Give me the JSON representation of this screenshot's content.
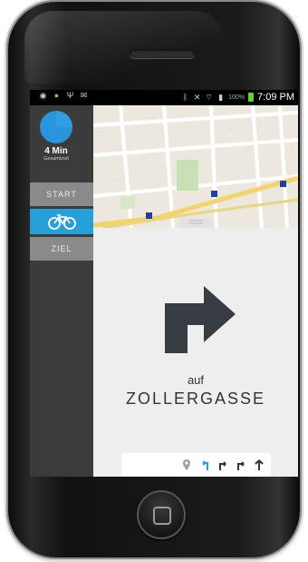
{
  "status_bar": {
    "time": "7:09 PM",
    "battery_percent": "100%",
    "icons": [
      "location-icon",
      "android-icon",
      "usb-icon",
      "mail-icon",
      "bluetooth-icon",
      "mute-icon",
      "wifi-icon",
      "signal-icon",
      "battery-icon"
    ]
  },
  "sidebar": {
    "duration_value": "4 Min",
    "duration_label": "Gesamtzeit",
    "start_label": "START",
    "mode_icon": "bicycle-icon",
    "destination_label": "ZIEL"
  },
  "navigation": {
    "instruction_prefix": "auf",
    "street_name": "ZOLLERGASSE",
    "main_arrow": "turn-right-arrow-icon",
    "steps": [
      "map-pin-icon",
      "u-turn-left-icon",
      "turn-right-icon",
      "turn-right-icon",
      "straight-icon"
    ]
  },
  "colors": {
    "accent_blue": "#27a0da",
    "sidebar_bg": "#3b3b3b",
    "sidebar_button": "#8a8a8a",
    "arrow": "#383c43"
  }
}
